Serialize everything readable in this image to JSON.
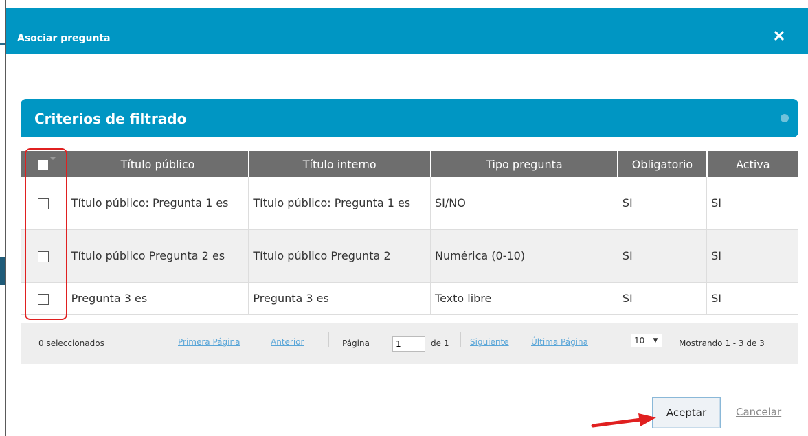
{
  "dialog": {
    "title": "Asociar pregunta",
    "close_icon": "close-icon"
  },
  "filter": {
    "title": "Criterios de filtrado",
    "collapse_icon": "circle-icon"
  },
  "table": {
    "columns": [
      "Título público",
      "Título interno",
      "Tipo pregunta",
      "Obligatorio",
      "Activa"
    ],
    "rows": [
      {
        "titulo_publico": "Título público: Pregunta 1 es",
        "titulo_interno": "Título público: Pregunta 1 es",
        "tipo": "SI/NO",
        "obligatorio": "SI",
        "activa": "SI"
      },
      {
        "titulo_publico": "Título público Pregunta 2 es",
        "titulo_interno": "Título público Pregunta 2",
        "tipo": "Numérica (0-10)",
        "obligatorio": "SI",
        "activa": "SI"
      },
      {
        "titulo_publico": "Pregunta 3 es",
        "titulo_interno": "Pregunta 3 es",
        "tipo": "Texto libre",
        "obligatorio": "SI",
        "activa": "SI"
      }
    ]
  },
  "pager": {
    "selected_count": "0 seleccionados",
    "first": "Primera Página",
    "prev": "Anterior",
    "page_label": "Página",
    "page_value": "1",
    "of_label": "de 1",
    "next": "Siguiente",
    "last": "Última Página",
    "page_size": "10",
    "showing": "Mostrando 1 - 3 de 3"
  },
  "actions": {
    "accept": "Aceptar",
    "cancel": "Cancelar"
  },
  "colors": {
    "header_blue": "#0096c3",
    "table_header": "#6e6e6e",
    "annotation_red": "#e02020"
  }
}
